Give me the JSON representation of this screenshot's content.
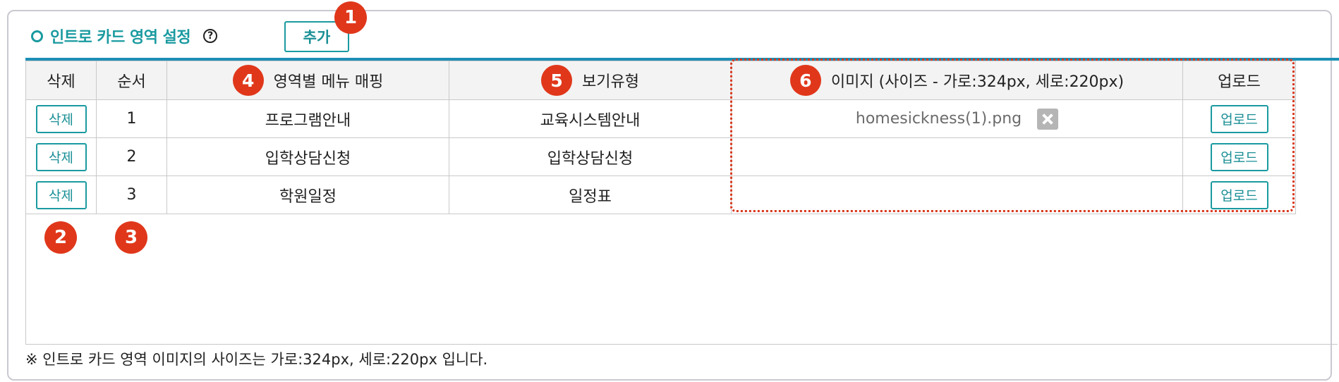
{
  "section": {
    "title": "인트로 카드 영역 설정",
    "help_icon": "?",
    "add_label": "추가"
  },
  "markers": [
    "1",
    "2",
    "3",
    "4",
    "5",
    "6"
  ],
  "table": {
    "headers": {
      "delete": "삭제",
      "order": "순서",
      "menu_mapping": "영역별 메뉴 매핑",
      "view_type": "보기유형",
      "image": "이미지 (사이즈 - 가로:324px, 세로:220px)",
      "upload": "업로드"
    },
    "rows": [
      {
        "delete_label": "삭제",
        "order": "1",
        "menu": "프로그램안내",
        "view_type": "교육시스템안내",
        "file": "homesickness(1).png",
        "upload_label": "업로드"
      },
      {
        "delete_label": "삭제",
        "order": "2",
        "menu": "입학상담신청",
        "view_type": "입학상담신청",
        "file": "",
        "upload_label": "업로드"
      },
      {
        "delete_label": "삭제",
        "order": "3",
        "menu": "학원일정",
        "view_type": "일정표",
        "file": "",
        "upload_label": "업로드"
      }
    ]
  },
  "footnote": "※ 인트로 카드 영역 이미지의 사이즈는 가로:324px, 세로:220px 입니다.",
  "colors": {
    "accent": "#1a9aa0",
    "top_rule": "#1c8fb5",
    "marker": "#e0371b",
    "header_bg": "#f3f3f3"
  }
}
